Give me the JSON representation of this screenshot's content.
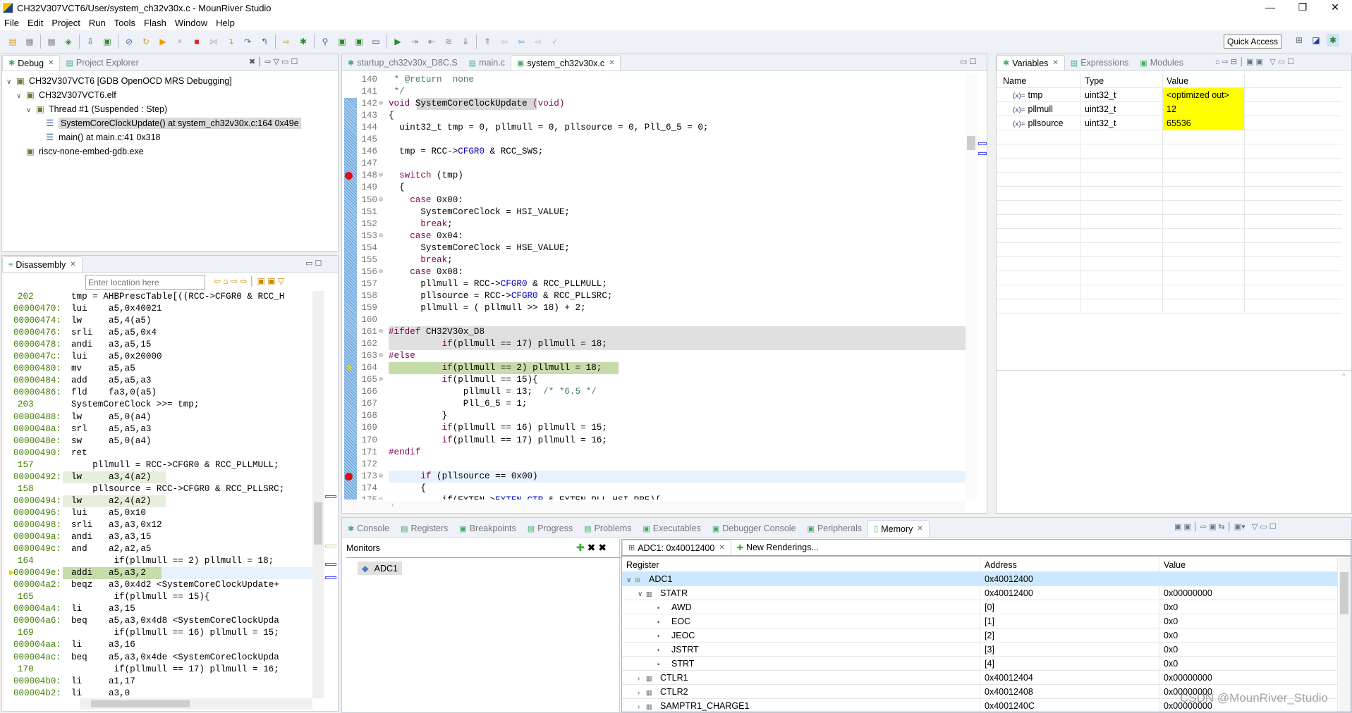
{
  "window": {
    "title": "CH32V307VCT6/User/system_ch32v30x.c - MounRiver Studio",
    "controls": [
      "—",
      "❐",
      "✕"
    ]
  },
  "menu": [
    "File",
    "Edit",
    "Project",
    "Run",
    "Tools",
    "Flash",
    "Window",
    "Help"
  ],
  "toolbar": {
    "icons": [
      "new-icon",
      "save-icon",
      "save-all-icon",
      "layers-icon",
      "download-icon",
      "console-icon",
      "skip-breakpoints-icon",
      "restart-icon",
      "resume-icon",
      "suspend-icon",
      "terminate-icon",
      "disconnect-icon",
      "step-into-icon",
      "step-over-icon",
      "step-return-icon",
      "instruction-step-icon",
      "debug-icon",
      "search-icon",
      "build-icon",
      "help-icon",
      "terminal-icon",
      "run-icon",
      "align-icon",
      "align2-icon",
      "format-icon",
      "next-annotation-icon",
      "prev-annotation-icon",
      "back-icon",
      "forward-icon",
      "pin-icon",
      "pin2-icon"
    ],
    "quick_access": "Quick Access",
    "perspectives": [
      "open-perspective-icon",
      "mounriver-icon",
      "debug-perspective-icon"
    ]
  },
  "debug_panel": {
    "tabs": [
      {
        "label": "Debug",
        "active": true
      },
      {
        "label": "Project Explorer",
        "active": false
      }
    ],
    "tree": [
      {
        "label": "CH32V307VCT6 [GDB OpenOCD MRS Debugging]",
        "level": 0,
        "expanded": true,
        "icon": "launch-icon"
      },
      {
        "label": "CH32V307VCT6.elf",
        "level": 1,
        "expanded": true,
        "icon": "elf-icon"
      },
      {
        "label": "Thread #1 (Suspended : Step)",
        "level": 2,
        "expanded": true,
        "icon": "thread-icon"
      },
      {
        "label": "SystemCoreClockUpdate() at system_ch32v30x.c:164 0x49e",
        "level": 3,
        "selected": true,
        "icon": "stack-frame-icon"
      },
      {
        "label": "main() at main.c:41 0x318",
        "level": 3,
        "icon": "stack-frame-icon"
      },
      {
        "label": "riscv-none-embed-gdb.exe",
        "level": 1,
        "icon": "gdb-icon"
      }
    ]
  },
  "disassembly": {
    "title": "Disassembly",
    "location_placeholder": "Enter location here",
    "rows": [
      {
        "src": "202",
        "text": "tmp = AHBPrescTable[((RCC->CFGR0 & RCC_H"
      },
      {
        "addr": "00000470:",
        "op": "lui",
        "args": "a5,0x40021"
      },
      {
        "addr": "00000474:",
        "op": "lw",
        "args": "a5,4(a5)"
      },
      {
        "addr": "00000476:",
        "op": "srli",
        "args": "a5,a5,0x4"
      },
      {
        "addr": "00000478:",
        "op": "andi",
        "args": "a3,a5,15"
      },
      {
        "addr": "0000047c:",
        "op": "lui",
        "args": "a5,0x20000"
      },
      {
        "addr": "00000480:",
        "op": "mv",
        "args": "a5,a5"
      },
      {
        "addr": "00000484:",
        "op": "add",
        "args": "a5,a5,a3"
      },
      {
        "addr": "00000486:",
        "op": "fld",
        "args": "fa3,0(a5)"
      },
      {
        "src": "203",
        "text": "SystemCoreClock >>= tmp;"
      },
      {
        "addr": "00000488:",
        "op": "lw",
        "args": "a5,0(a4)"
      },
      {
        "addr": "0000048a:",
        "op": "srl",
        "args": "a5,a5,a3"
      },
      {
        "addr": "0000048e:",
        "op": "sw",
        "args": "a5,0(a4)"
      },
      {
        "addr": "00000490:",
        "op": "ret",
        "args": ""
      },
      {
        "src": "157",
        "text": "    pllmull = RCC->CFGR0 & RCC_PLLMULL;"
      },
      {
        "addr": "00000492:",
        "op": "lw",
        "args": "a3,4(a2)",
        "hl": "light"
      },
      {
        "src": "158",
        "text": "    pllsource = RCC->CFGR0 & RCC_PLLSRC;"
      },
      {
        "addr": "00000494:",
        "op": "lw",
        "args": "a2,4(a2)",
        "hl": "light"
      },
      {
        "addr": "00000496:",
        "op": "lui",
        "args": "a5,0x10"
      },
      {
        "addr": "00000498:",
        "op": "srli",
        "args": "a3,a3,0x12"
      },
      {
        "addr": "0000049a:",
        "op": "andi",
        "args": "a3,a3,15"
      },
      {
        "addr": "0000049c:",
        "op": "and",
        "args": "a2,a2,a5"
      },
      {
        "src": "164",
        "text": "        if(pllmull == 2) pllmull = 18;"
      },
      {
        "addr": "0000049e:",
        "op": "addi",
        "args": "a5,a3,2",
        "hl": "current"
      },
      {
        "addr": "000004a2:",
        "op": "beqz",
        "args": "a3,0x4d2 <SystemCoreClockUpdate+"
      },
      {
        "src": "165",
        "text": "        if(pllmull == 15){"
      },
      {
        "addr": "000004a4:",
        "op": "li",
        "args": "a3,15"
      },
      {
        "addr": "000004a6:",
        "op": "beq",
        "args": "a5,a3,0x4d8 <SystemCoreClockUpda"
      },
      {
        "src": "169",
        "text": "        if(pllmull == 16) pllmull = 15;"
      },
      {
        "addr": "000004aa:",
        "op": "li",
        "args": "a3,16"
      },
      {
        "addr": "000004ac:",
        "op": "beq",
        "args": "a5,a3,0x4de <SystemCoreClockUpda"
      },
      {
        "src": "170",
        "text": "        if(pllmull == 17) pllmull = 16;"
      },
      {
        "addr": "000004b0:",
        "op": "li",
        "args": "a1,17"
      },
      {
        "addr": "000004b2:",
        "op": "li",
        "args": "a3,0"
      }
    ]
  },
  "editor": {
    "tabs": [
      {
        "label": "startup_ch32v30x_D8C.S",
        "active": false
      },
      {
        "label": "main.c",
        "active": false
      },
      {
        "label": "system_ch32v30x.c",
        "active": true
      }
    ],
    "lines": [
      {
        "n": "140",
        "seg": [
          [
            " * @return  none",
            "c"
          ]
        ]
      },
      {
        "n": "141",
        "seg": [
          [
            " */",
            "c"
          ]
        ]
      },
      {
        "n": "142",
        "fold": true,
        "seg": [
          [
            "void ",
            "k"
          ],
          [
            "SystemCoreClockUpdate",
            "t"
          ],
          [
            " (void)",
            "k"
          ]
        ]
      },
      {
        "n": "143",
        "seg": [
          [
            "{",
            "t"
          ]
        ]
      },
      {
        "n": "144",
        "seg": [
          [
            "  uint32_t tmp = 0, pllmull = 0, pllsource = 0, Pll_6_5 = 0;",
            "t"
          ]
        ]
      },
      {
        "n": "145",
        "seg": []
      },
      {
        "n": "146",
        "seg": [
          [
            "  tmp = RCC->",
            "t"
          ],
          [
            "CFGR0",
            "f"
          ],
          [
            " & RCC_SWS;",
            "t"
          ]
        ]
      },
      {
        "n": "147",
        "seg": []
      },
      {
        "n": "148",
        "fold": true,
        "bp": true,
        "seg": [
          [
            "  switch",
            "k"
          ],
          [
            " (tmp)",
            "t"
          ]
        ]
      },
      {
        "n": "149",
        "seg": [
          [
            "  {",
            "t"
          ]
        ]
      },
      {
        "n": "150",
        "fold": true,
        "seg": [
          [
            "    case",
            "k"
          ],
          [
            " 0x00:",
            "t"
          ]
        ]
      },
      {
        "n": "151",
        "seg": [
          [
            "      SystemCoreClock = HSI_VALUE;",
            "t"
          ]
        ]
      },
      {
        "n": "152",
        "seg": [
          [
            "      break",
            "k"
          ],
          [
            ";",
            "t"
          ]
        ]
      },
      {
        "n": "153",
        "fold": true,
        "seg": [
          [
            "    case",
            "k"
          ],
          [
            " 0x04:",
            "t"
          ]
        ]
      },
      {
        "n": "154",
        "seg": [
          [
            "      SystemCoreClock = HSE_VALUE;",
            "t"
          ]
        ]
      },
      {
        "n": "155",
        "seg": [
          [
            "      break",
            "k"
          ],
          [
            ";",
            "t"
          ]
        ]
      },
      {
        "n": "156",
        "fold": true,
        "seg": [
          [
            "    case",
            "k"
          ],
          [
            " 0x08:",
            "t"
          ]
        ]
      },
      {
        "n": "157",
        "seg": [
          [
            "      pllmull = RCC->",
            "t"
          ],
          [
            "CFGR0",
            "f"
          ],
          [
            " & RCC_PLLMULL;",
            "t"
          ]
        ]
      },
      {
        "n": "158",
        "seg": [
          [
            "      pllsource = RCC->",
            "t"
          ],
          [
            "CFGR0",
            "f"
          ],
          [
            " & RCC_PLLSRC;",
            "t"
          ]
        ]
      },
      {
        "n": "159",
        "seg": [
          [
            "      pllmull = ( pllmull >> 18) + 2;",
            "t"
          ]
        ]
      },
      {
        "n": "160",
        "seg": []
      },
      {
        "n": "161",
        "fold": true,
        "hl": "inactive",
        "seg": [
          [
            "#ifdef",
            "k"
          ],
          [
            " CH32V30x_D8",
            "t"
          ]
        ]
      },
      {
        "n": "162",
        "hl": "inactive",
        "seg": [
          [
            "          if",
            "k"
          ],
          [
            "(pllmull == 17) pllmull = 18;",
            "t"
          ]
        ]
      },
      {
        "n": "163",
        "fold": true,
        "seg": [
          [
            "#else",
            "k"
          ]
        ]
      },
      {
        "n": "164",
        "hl": "current",
        "arrow": true,
        "seg": [
          [
            "          if",
            "k"
          ],
          [
            "(pllmull == 2) pllmull = 18;",
            "t"
          ]
        ]
      },
      {
        "n": "165",
        "fold": true,
        "seg": [
          [
            "          if",
            "k"
          ],
          [
            "(pllmull == 15){",
            "t"
          ]
        ]
      },
      {
        "n": "166",
        "seg": [
          [
            "              pllmull = 13;  ",
            "t"
          ],
          [
            "/* *6.5 */",
            "c"
          ]
        ]
      },
      {
        "n": "167",
        "seg": [
          [
            "              Pll_6_5 = 1;",
            "t"
          ]
        ]
      },
      {
        "n": "168",
        "seg": [
          [
            "          }",
            "t"
          ]
        ]
      },
      {
        "n": "169",
        "seg": [
          [
            "          if",
            "k"
          ],
          [
            "(pllmull == 16) pllmull = 15;",
            "t"
          ]
        ]
      },
      {
        "n": "170",
        "seg": [
          [
            "          if",
            "k"
          ],
          [
            "(pllmull == 17) pllmull = 16;",
            "t"
          ]
        ]
      },
      {
        "n": "171",
        "seg": [
          [
            "#endif",
            "k"
          ]
        ]
      },
      {
        "n": "172",
        "seg": []
      },
      {
        "n": "173",
        "fold": true,
        "bp": true,
        "hl": "cursor",
        "seg": [
          [
            "      if",
            "k"
          ],
          [
            " (pllsource == 0x00)",
            "t"
          ]
        ]
      },
      {
        "n": "174",
        "seg": [
          [
            "      {",
            "t"
          ]
        ]
      },
      {
        "n": "175",
        "fold": true,
        "seg": [
          [
            "          if(EXTEN->",
            "t"
          ],
          [
            "EXTEN_CTR",
            "f"
          ],
          [
            " & EXTEN_PLL_HSI_PRE){",
            "t"
          ]
        ]
      }
    ]
  },
  "variables": {
    "tabs": [
      {
        "label": "Variables",
        "active": true
      },
      {
        "label": "Expressions",
        "active": false
      },
      {
        "label": "Modules",
        "active": false
      }
    ],
    "columns": [
      "Name",
      "Type",
      "Value"
    ],
    "rows": [
      {
        "name": "tmp",
        "type": "uint32_t",
        "value": "<optimized out>",
        "changed": true
      },
      {
        "name": "pllmull",
        "type": "uint32_t",
        "value": "12",
        "changed": true
      },
      {
        "name": "pllsource",
        "type": "uint32_t",
        "value": "65536",
        "changed": true
      }
    ],
    "changed_color": "#ffff00"
  },
  "bottom": {
    "tabs": [
      {
        "label": "Console",
        "active": false
      },
      {
        "label": "Registers",
        "active": false
      },
      {
        "label": "Breakpoints",
        "active": false
      },
      {
        "label": "Progress",
        "active": false
      },
      {
        "label": "Problems",
        "active": false
      },
      {
        "label": "Executables",
        "active": false
      },
      {
        "label": "Debugger Console",
        "active": false
      },
      {
        "label": "Peripherals",
        "active": false
      },
      {
        "label": "Memory",
        "active": true
      }
    ],
    "monitors_label": "Monitors",
    "monitors": [
      "ADC1"
    ],
    "rendering_tab": "ADC1: 0x40012400",
    "new_renderings": "New Renderings...",
    "columns": [
      "Register",
      "Address",
      "Value"
    ],
    "rows": [
      {
        "name": "ADC1",
        "address": "0x40012400",
        "value": "",
        "level": 0,
        "toggle": "v",
        "selected": true
      },
      {
        "name": "STATR",
        "address": "0x40012400",
        "value": "0x00000000",
        "level": 1,
        "toggle": "v"
      },
      {
        "name": "AWD",
        "address": "[0]",
        "value": "0x0",
        "level": 2
      },
      {
        "name": "EOC",
        "address": "[1]",
        "value": "0x0",
        "level": 2
      },
      {
        "name": "JEOC",
        "address": "[2]",
        "value": "0x0",
        "level": 2
      },
      {
        "name": "JSTRT",
        "address": "[3]",
        "value": "0x0",
        "level": 2
      },
      {
        "name": "STRT",
        "address": "[4]",
        "value": "0x0",
        "level": 2
      },
      {
        "name": "CTLR1",
        "address": "0x40012404",
        "value": "0x00000000",
        "level": 1,
        "toggle": ">"
      },
      {
        "name": "CTLR2",
        "address": "0x40012408",
        "value": "0x00000000",
        "level": 1,
        "toggle": ">"
      },
      {
        "name": "SAMPTR1_CHARGE1",
        "address": "0x4001240C",
        "value": "0x00000000",
        "level": 1,
        "toggle": ">"
      }
    ]
  },
  "watermark": "CSDN @MounRiver_Studio"
}
